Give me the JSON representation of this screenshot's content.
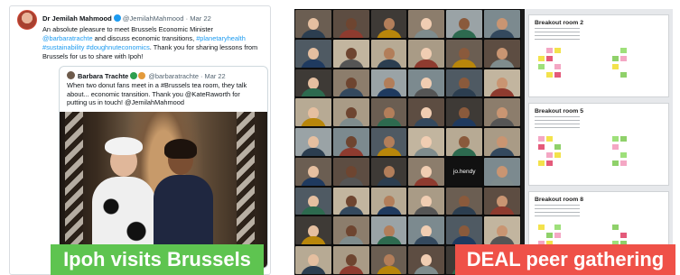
{
  "tweet": {
    "author_name": "Dr Jemilah Mahmood",
    "author_handle": "@JemilahMahmood",
    "date": "· Mar 22",
    "text_1": "An absolute pleasure to meet Brussels Economic Minister ",
    "mention_1": "@barbaratrachte",
    "text_2": " and discuss economic transitions, ",
    "hashtag_1": "#planetaryhealth",
    "text_3": " ",
    "hashtag_2": "#sustainability",
    "text_4": " ",
    "hashtag_3": "#doughnuteconomics",
    "text_5": ". Thank you for sharing lessons from Brussels for us to share with Ipoh!",
    "quote": {
      "author_name": "Barbara Trachte",
      "author_handle": "@barbaratrachte",
      "date": "· Mar 22",
      "text": "When two donut fans meet in a #Brussels tea room, they talk about... economic transition. Thank you @KateRaworth for putting us in touch! @JemilahMahmood"
    }
  },
  "captions": {
    "left": "Ipoh visits Brussels",
    "right": "DEAL peer gathering"
  },
  "video_grid": {
    "highlighted_label": "jo.hendy"
  },
  "boards": [
    {
      "title": "Breakout room 2"
    },
    {
      "title": "Breakout room 5"
    },
    {
      "title": "Breakout room 8"
    }
  ],
  "colors": {
    "caption_left_bg": "#5ec450",
    "caption_right_bg": "#ef5148",
    "link": "#1d9bf0"
  }
}
